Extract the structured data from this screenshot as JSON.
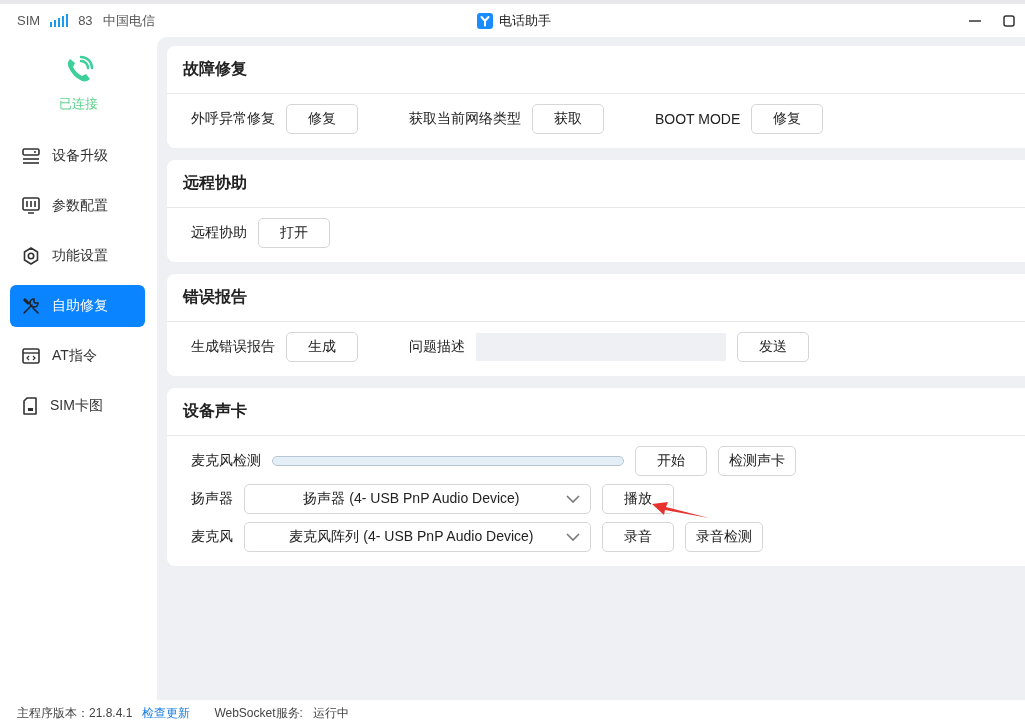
{
  "status": {
    "sim_label": "SIM",
    "signal_value": "83",
    "carrier": "中国电信"
  },
  "window": {
    "title": "电话助手"
  },
  "connection": {
    "label": "已连接"
  },
  "sidebar": {
    "items": [
      {
        "label": "设备升级",
        "kind": "upgrade",
        "selected": false
      },
      {
        "label": "参数配置",
        "kind": "params",
        "selected": false
      },
      {
        "label": "功能设置",
        "kind": "gear",
        "selected": false
      },
      {
        "label": "自助修复",
        "kind": "tools",
        "selected": true
      },
      {
        "label": "AT指令",
        "kind": "code",
        "selected": false
      },
      {
        "label": "SIM卡图",
        "kind": "sim",
        "selected": false
      }
    ]
  },
  "sections": [
    {
      "title": "故障修复",
      "rows": [
        [
          {
            "kind": "label",
            "text": "外呼异常修复"
          },
          {
            "kind": "button",
            "text": "修复"
          },
          {
            "kind": "label",
            "text": "获取当前网络类型"
          },
          {
            "kind": "button",
            "text": "获取"
          },
          {
            "kind": "label",
            "text": "BOOT MODE"
          },
          {
            "kind": "button",
            "text": "修复"
          }
        ]
      ]
    },
    {
      "title": "远程协助",
      "rows": [
        [
          {
            "kind": "label",
            "text": "远程协助"
          },
          {
            "kind": "button",
            "text": "打开"
          }
        ]
      ]
    },
    {
      "title": "错误报告",
      "rows": [
        [
          {
            "kind": "label",
            "text": "生成错误报告"
          },
          {
            "kind": "button",
            "text": "生成"
          },
          {
            "kind": "label",
            "text": "问题描述"
          },
          {
            "kind": "input"
          },
          {
            "kind": "button",
            "text": "发送"
          }
        ]
      ]
    },
    {
      "title": "设备声卡",
      "rows": [
        [
          {
            "kind": "label",
            "text": "麦克风检测"
          },
          {
            "kind": "meter",
            "level": 0
          },
          {
            "kind": "button",
            "text": "开始"
          },
          {
            "kind": "button",
            "text": "检测声卡"
          }
        ],
        [
          {
            "kind": "label",
            "text": "扬声器"
          },
          {
            "kind": "select",
            "text": "扬声器 (4- USB PnP Audio Device)"
          },
          {
            "kind": "button",
            "text": "播放",
            "annotated": true
          }
        ],
        [
          {
            "kind": "label",
            "text": "麦克风"
          },
          {
            "kind": "select",
            "text": "麦克风阵列 (4- USB PnP Audio Device)"
          },
          {
            "kind": "button",
            "text": "录音"
          },
          {
            "kind": "button",
            "text": "录音检测"
          }
        ]
      ]
    }
  ],
  "footer": {
    "version": "主程序版本：21.8.4.1",
    "update_link": "检查更新",
    "service_label": "WebSocket服务:",
    "service_status": "运行中"
  }
}
